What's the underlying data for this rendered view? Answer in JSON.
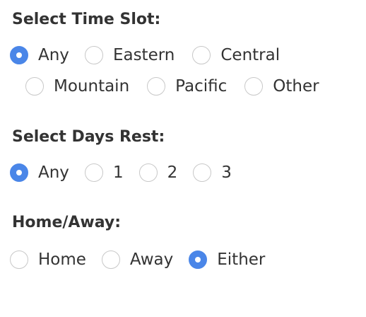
{
  "time_slot": {
    "title": "Select Time Slot:",
    "options": [
      "Any",
      "Eastern",
      "Central",
      "Mountain",
      "Pacific",
      "Other"
    ],
    "selected": "Any"
  },
  "days_rest": {
    "title": "Select Days Rest:",
    "options": [
      "Any",
      "1",
      "2",
      "3"
    ],
    "selected": "Any"
  },
  "home_away": {
    "title": "Home/Away:",
    "options": [
      "Home",
      "Away",
      "Either"
    ],
    "selected": "Either"
  },
  "colors": {
    "accent": "#4a86e8",
    "text": "#333333",
    "radio_border": "#c8c8c8"
  }
}
